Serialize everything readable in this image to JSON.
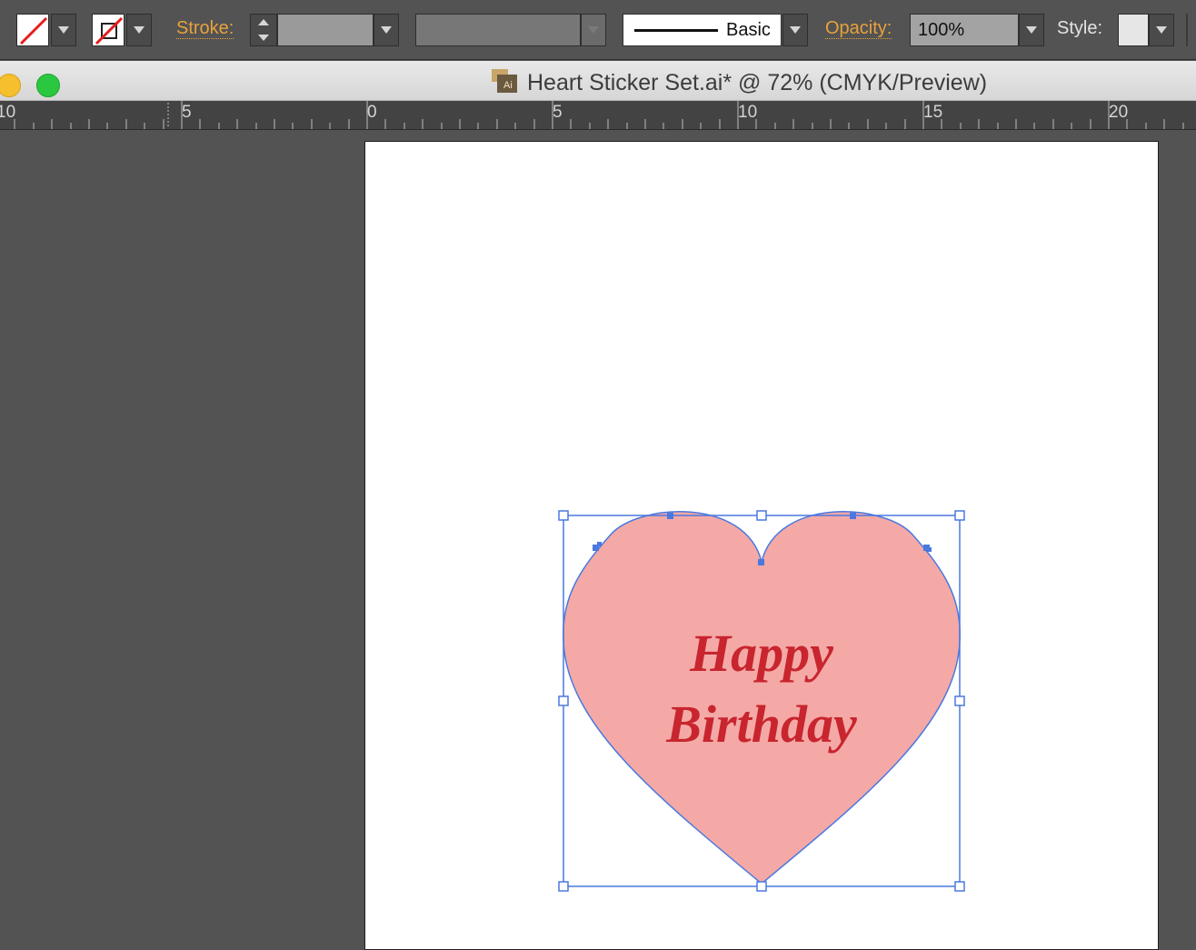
{
  "control_bar": {
    "fill_swatch_icon": "no-fill-swatch-icon",
    "stroke_swatch_icon": "no-stroke-swatch-icon",
    "stroke_label": "Stroke:",
    "stroke_weight_value": "",
    "variable_width_value": "",
    "brush_label": "Basic",
    "opacity_label": "Opacity:",
    "opacity_value": "100%",
    "style_label": "Style:",
    "accent_label_color": "#e8a23c"
  },
  "window": {
    "title": "Heart Sticker Set.ai* @ 72% (CMYK/Preview)",
    "doc_icon_label": "Ai",
    "traffic_lights": [
      "minimize",
      "zoom"
    ]
  },
  "ruler": {
    "labels": [
      "10",
      "5",
      "0",
      "5",
      "10",
      "15",
      "20"
    ]
  },
  "artboard": {
    "heart_fill": "#f4a9a6",
    "text_color": "#c8252f",
    "selection_color": "#4a78e0",
    "text_line1": "Happy",
    "text_line2": "Birthday"
  }
}
